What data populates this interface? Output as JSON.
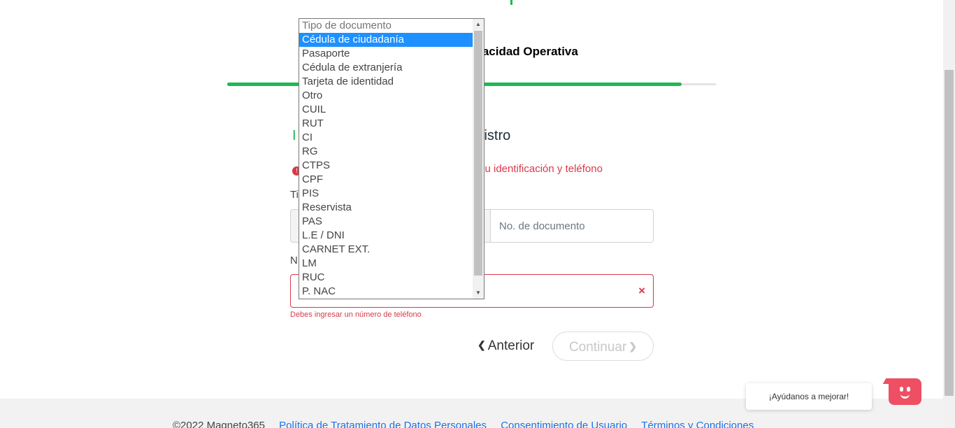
{
  "header": {
    "step_title": "de Capacidad Operativa",
    "progress_fraction": 0.93
  },
  "section": {
    "heading_left": "I",
    "heading_right": "registro"
  },
  "alert": {
    "icon": "!",
    "text": "su identificación y teléfono"
  },
  "form": {
    "doc_type_label": "Ti",
    "doc_number_placeholder": "No. de documento",
    "phone_label": "N",
    "phone_clear_icon": "×",
    "phone_error": "Debes ingresar un número de teléfono"
  },
  "dropdown": {
    "options": [
      "Tipo de documento",
      "Cédula de ciudadanía",
      "Pasaporte",
      "Cédula de extranjería",
      "Tarjeta de identidad",
      "Otro",
      "CUIL",
      "RUT",
      "CI",
      "RG",
      "CTPS",
      "CPF",
      "PIS",
      "Reservista",
      "PAS",
      "L.E / DNI",
      "CARNET EXT.",
      "LM",
      "RUC",
      "P. NAC"
    ],
    "selected_index": 1,
    "placeholder_index": 0
  },
  "nav": {
    "prev_label": "Anterior",
    "next_label": "Continuar"
  },
  "footer": {
    "copyright": "©2022 Magneto365",
    "links": [
      "Política de Tratamiento de Datos Personales",
      "Consentimiento de Usuario",
      "Términos y Condiciones"
    ]
  },
  "feedback": {
    "bubble_text": "¡Ayúdanos a mejorar!"
  },
  "colors": {
    "accent": "#1db954",
    "error": "#d9394a",
    "selected": "#1e90ff",
    "feedback_bot": "#ee4f63"
  }
}
